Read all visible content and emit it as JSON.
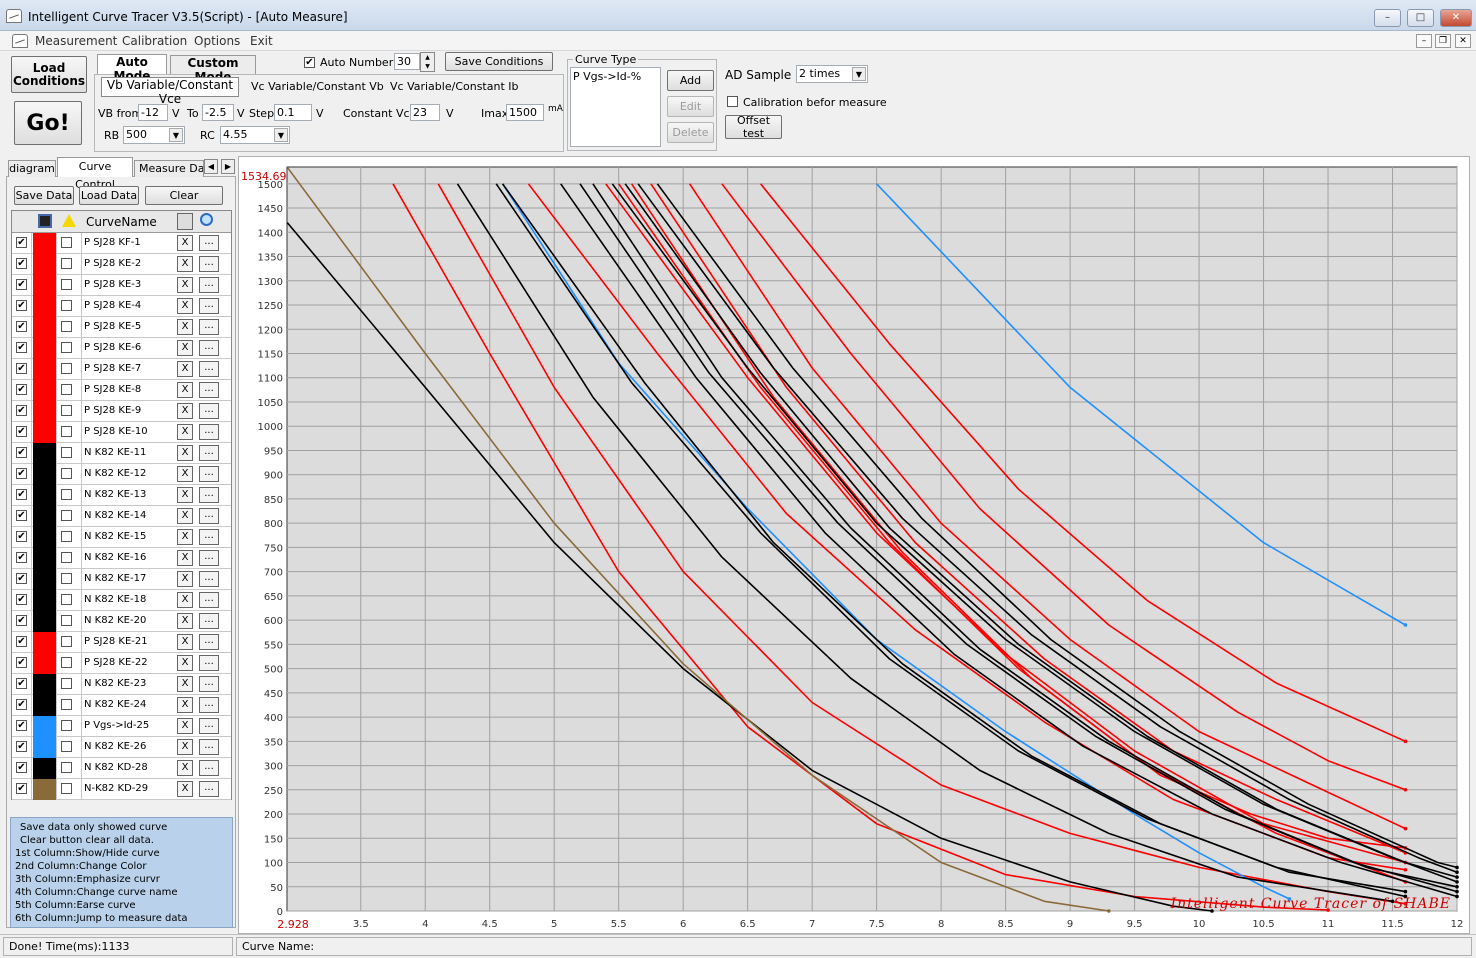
{
  "window": {
    "title": "Intelligent Curve Tracer V3.5(Script) - [Auto Measure]"
  },
  "menu": [
    "Measurement",
    "Calibration",
    "Options",
    "Exit"
  ],
  "toolbar": {
    "load_conditions": "Load\nConditions",
    "go": "Go!",
    "auto_mode": "Auto Mode",
    "custom_mode": "Custom Mode",
    "auto_number_label": "Auto Number",
    "auto_number_value": "30",
    "save_conditions": "Save Conditions",
    "subtabs": [
      "Vb Variable/Constant Vce",
      "Vc Variable/Constant Vb",
      "Vc Variable/Constant Ib"
    ],
    "vb_from_label": "VB from",
    "vb_from_value": "-12",
    "unit_v": "V",
    "to_label": "To",
    "to_value": "-2.5",
    "step_label": "Step",
    "step_value": "0.1",
    "const_vce_label": "Constant Vce",
    "const_vce_value": "23",
    "imax_label": "Imax",
    "imax_value": "1500",
    "imax_unit": "mA",
    "rb_label": "RB",
    "rb_value": "500",
    "rc_label": "RC",
    "rc_value": "4.55"
  },
  "curve_type": {
    "title": "Curve Type",
    "items": [
      "P Vgs->Id-%"
    ],
    "add": "Add",
    "edit": "Edit",
    "delete": "Delete"
  },
  "ad": {
    "label": "AD Sample",
    "value": "2 times",
    "calib_label": "Calibration befor measure",
    "offset_test": "Offset test"
  },
  "left_tabs": [
    "diagram",
    "Curve Control",
    "Measure Data"
  ],
  "left_buttons": {
    "save": "Save Data",
    "load": "Load Data",
    "clear": "Clear"
  },
  "table": {
    "header_name": "CurveName",
    "rows": [
      {
        "name": "P SJ28 KF-1",
        "color": "#ff0000"
      },
      {
        "name": "P  SJ28 KE-2",
        "color": "#ff0000"
      },
      {
        "name": "P SJ28 KE-3",
        "color": "#ff0000"
      },
      {
        "name": "P SJ28 KE-4",
        "color": "#ff0000"
      },
      {
        "name": "P SJ28 KE-5",
        "color": "#ff0000"
      },
      {
        "name": "P SJ28 KE-6",
        "color": "#ff0000"
      },
      {
        "name": "P SJ28 KE-7",
        "color": "#ff0000"
      },
      {
        "name": "P SJ28 KE-8",
        "color": "#ff0000"
      },
      {
        "name": "P SJ28 KE-9",
        "color": "#ff0000"
      },
      {
        "name": "P SJ28 KE-10",
        "color": "#ff0000"
      },
      {
        "name": "N K82 KE-11",
        "color": "#000000"
      },
      {
        "name": "N K82 KE-12",
        "color": "#000000"
      },
      {
        "name": "N  K82 KE-13",
        "color": "#000000"
      },
      {
        "name": "N K82 KE-14",
        "color": "#000000"
      },
      {
        "name": "N  K82 KE-15",
        "color": "#000000"
      },
      {
        "name": "N K82 KE-16",
        "color": "#000000"
      },
      {
        "name": "N K82 KE-17",
        "color": "#000000"
      },
      {
        "name": "N K82 KE-18",
        "color": "#000000"
      },
      {
        "name": "N  K82 KE-20",
        "color": "#000000"
      },
      {
        "name": "P SJ28 KE-21",
        "color": "#ff0000"
      },
      {
        "name": "P SJ28 KE-22",
        "color": "#ff0000"
      },
      {
        "name": "N K82 KE-23",
        "color": "#000000"
      },
      {
        "name": "N  K82 KE-24",
        "color": "#000000"
      },
      {
        "name": "P Vgs->Id-25",
        "color": "#1e90ff"
      },
      {
        "name": "N  K82 KE-26",
        "color": "#1e90ff"
      },
      {
        "name": "N K82 KD-28",
        "color": "#000000"
      },
      {
        "name": "N-K82 KD-29",
        "color": "#8b6a3a"
      }
    ],
    "x_label": "X",
    "dots_label": "..."
  },
  "help": [
    "Save data only showed curve",
    "Clear button clear all data.",
    "1st Column:Show/Hide curve",
    "2nd Column:Change Color",
    "3th Column:Emphasize curvr",
    "4th Column:Change curve name",
    "5th Column:Earse curve",
    "6th Column:Jump to measure data"
  ],
  "status": {
    "left": "Done!  Time(ms):1133",
    "right": "Curve Name:"
  },
  "chart_data": {
    "type": "line",
    "x_ticks": [
      3.5,
      4,
      4.5,
      5,
      5.5,
      6,
      6.5,
      7,
      7.5,
      8,
      8.5,
      9,
      9.5,
      10,
      10.5,
      11,
      11.5,
      12
    ],
    "y_ticks": [
      0,
      50,
      100,
      150,
      200,
      250,
      300,
      350,
      400,
      450,
      500,
      550,
      600,
      650,
      700,
      750,
      800,
      850,
      900,
      950,
      1000,
      1050,
      1100,
      1150,
      1200,
      1250,
      1300,
      1350,
      1400,
      1450,
      1500
    ],
    "xlim": [
      2.928,
      12
    ],
    "ylim": [
      0,
      1534.69
    ],
    "x_min_label": "2.928",
    "y_max_label": "1534.69",
    "grid": true,
    "watermark": "Intelligent Curve Tracer of SHABE",
    "series": [
      {
        "color": "#ff0000",
        "points": [
          [
            3.75,
            1500
          ],
          [
            4.5,
            1150
          ],
          [
            5.5,
            700
          ],
          [
            6.5,
            380
          ],
          [
            7.5,
            180
          ],
          [
            8.5,
            75
          ],
          [
            9.5,
            30
          ],
          [
            10.5,
            8
          ],
          [
            11,
            2
          ]
        ]
      },
      {
        "color": "#ff0000",
        "points": [
          [
            4.1,
            1500
          ],
          [
            5,
            1080
          ],
          [
            6,
            700
          ],
          [
            7,
            430
          ],
          [
            8,
            260
          ],
          [
            9,
            160
          ],
          [
            10,
            90
          ],
          [
            11,
            40
          ],
          [
            11.6,
            15
          ]
        ]
      },
      {
        "color": "#1e90ff",
        "points": [
          [
            4.6,
            1500
          ],
          [
            5.5,
            1130
          ],
          [
            6.5,
            830
          ],
          [
            7.5,
            560
          ],
          [
            8.5,
            370
          ],
          [
            9.5,
            200
          ],
          [
            10,
            120
          ],
          [
            10.5,
            50
          ],
          [
            10.7,
            25
          ]
        ]
      },
      {
        "color": "#ff0000",
        "points": [
          [
            4.8,
            1500
          ],
          [
            5.8,
            1150
          ],
          [
            6.8,
            820
          ],
          [
            7.8,
            580
          ],
          [
            8.8,
            390
          ],
          [
            9.8,
            230
          ],
          [
            10.5,
            160
          ],
          [
            11,
            110
          ],
          [
            11.6,
            85
          ]
        ]
      },
      {
        "color": "#ff0000",
        "points": [
          [
            5.75,
            1500
          ],
          [
            6.8,
            1080
          ],
          [
            7.8,
            760
          ],
          [
            8.8,
            520
          ],
          [
            9.8,
            330
          ],
          [
            10.6,
            230
          ],
          [
            11.6,
            120
          ]
        ]
      },
      {
        "color": "#ff0000",
        "points": [
          [
            6.05,
            1500
          ],
          [
            7,
            1120
          ],
          [
            8,
            800
          ],
          [
            9,
            560
          ],
          [
            10,
            370
          ],
          [
            10.8,
            270
          ],
          [
            11.6,
            170
          ]
        ]
      },
      {
        "color": "#ff0000",
        "points": [
          [
            6.3,
            1500
          ],
          [
            7.3,
            1150
          ],
          [
            8.3,
            830
          ],
          [
            9.3,
            590
          ],
          [
            10.3,
            410
          ],
          [
            11,
            310
          ],
          [
            11.6,
            250
          ]
        ]
      },
      {
        "color": "#ff0000",
        "points": [
          [
            6.6,
            1500
          ],
          [
            7.6,
            1170
          ],
          [
            8.6,
            870
          ],
          [
            9.6,
            640
          ],
          [
            10.6,
            470
          ],
          [
            11.6,
            350
          ]
        ]
      },
      {
        "color": "#ff0000",
        "points": [
          [
            5.4,
            1500
          ],
          [
            6.5,
            1100
          ],
          [
            7.5,
            780
          ],
          [
            8.5,
            530
          ],
          [
            9.5,
            330
          ],
          [
            10.5,
            180
          ],
          [
            11.6,
            100
          ]
        ]
      },
      {
        "color": "#ff0000",
        "points": [
          [
            5.5,
            1500
          ],
          [
            6.6,
            1080
          ],
          [
            7.6,
            760
          ],
          [
            8.6,
            500
          ],
          [
            9.6,
            300
          ],
          [
            10.6,
            160
          ],
          [
            11.6,
            60
          ]
        ]
      },
      {
        "color": "#ff0000",
        "points": [
          [
            5.6,
            1500
          ],
          [
            6.7,
            1060
          ],
          [
            7.7,
            740
          ],
          [
            8.7,
            480
          ],
          [
            9.7,
            280
          ],
          [
            10.4,
            200
          ],
          [
            11,
            150
          ],
          [
            11.6,
            130
          ]
        ]
      },
      {
        "color": "#1e90ff",
        "points": [
          [
            7.5,
            1500
          ],
          [
            9,
            1080
          ],
          [
            10.5,
            760
          ],
          [
            11.6,
            590
          ]
        ]
      },
      {
        "color": "#000000",
        "points": [
          [
            2.93,
            1420
          ],
          [
            4,
            1080
          ],
          [
            5,
            760
          ],
          [
            6,
            500
          ],
          [
            7,
            290
          ],
          [
            8,
            150
          ],
          [
            9,
            60
          ],
          [
            9.8,
            10
          ],
          [
            10.1,
            0
          ]
        ]
      },
      {
        "color": "#8b6a3a",
        "points": [
          [
            2.93,
            1534
          ],
          [
            4,
            1150
          ],
          [
            5,
            800
          ],
          [
            6,
            510
          ],
          [
            7,
            280
          ],
          [
            8,
            100
          ],
          [
            8.8,
            20
          ],
          [
            9.3,
            0
          ]
        ]
      },
      {
        "color": "#000000",
        "points": [
          [
            4.25,
            1500
          ],
          [
            5.3,
            1060
          ],
          [
            6.3,
            730
          ],
          [
            7.3,
            480
          ],
          [
            8.3,
            290
          ],
          [
            9.3,
            160
          ],
          [
            10.3,
            70
          ],
          [
            11.5,
            20
          ]
        ]
      },
      {
        "color": "#000000",
        "points": [
          [
            4.55,
            1500
          ],
          [
            5.6,
            1090
          ],
          [
            6.6,
            780
          ],
          [
            7.6,
            520
          ],
          [
            8.6,
            330
          ],
          [
            9.6,
            190
          ],
          [
            10.6,
            90
          ],
          [
            11.6,
            30
          ]
        ]
      },
      {
        "color": "#000000",
        "points": [
          [
            4.6,
            1500
          ],
          [
            5.7,
            1090
          ],
          [
            6.7,
            760
          ],
          [
            7.7,
            510
          ],
          [
            8.7,
            320
          ],
          [
            9.7,
            180
          ],
          [
            10.7,
            80
          ],
          [
            11.6,
            40
          ]
        ]
      },
      {
        "color": "#000000",
        "points": [
          [
            5.05,
            1500
          ],
          [
            6.1,
            1100
          ],
          [
            7.1,
            780
          ],
          [
            8.1,
            530
          ],
          [
            9.1,
            340
          ],
          [
            10.1,
            200
          ],
          [
            11.1,
            100
          ],
          [
            12,
            30
          ]
        ]
      },
      {
        "color": "#000000",
        "points": [
          [
            5.2,
            1500
          ],
          [
            6.2,
            1110
          ],
          [
            7.2,
            800
          ],
          [
            8.2,
            550
          ],
          [
            9.2,
            360
          ],
          [
            10.2,
            210
          ],
          [
            11.2,
            100
          ],
          [
            12,
            40
          ]
        ]
      },
      {
        "color": "#000000",
        "points": [
          [
            5.3,
            1500
          ],
          [
            6.3,
            1100
          ],
          [
            7.3,
            790
          ],
          [
            8.3,
            540
          ],
          [
            9.3,
            350
          ],
          [
            10.3,
            200
          ],
          [
            11.3,
            90
          ],
          [
            12,
            50
          ]
        ]
      },
      {
        "color": "#000000",
        "points": [
          [
            5.45,
            1500
          ],
          [
            6.5,
            1120
          ],
          [
            7.5,
            800
          ],
          [
            8.5,
            560
          ],
          [
            9.5,
            370
          ],
          [
            10.5,
            220
          ],
          [
            11.5,
            110
          ],
          [
            12,
            60
          ]
        ]
      },
      {
        "color": "#000000",
        "points": [
          [
            5.55,
            1500
          ],
          [
            6.6,
            1110
          ],
          [
            7.6,
            790
          ],
          [
            8.6,
            550
          ],
          [
            9.6,
            360
          ],
          [
            10.6,
            210
          ],
          [
            11.6,
            100
          ],
          [
            12,
            70
          ]
        ]
      },
      {
        "color": "#000000",
        "points": [
          [
            5.65,
            1500
          ],
          [
            6.7,
            1120
          ],
          [
            7.7,
            810
          ],
          [
            8.7,
            570
          ],
          [
            9.7,
            380
          ],
          [
            10.7,
            230
          ],
          [
            11.7,
            110
          ],
          [
            12,
            80
          ]
        ]
      },
      {
        "color": "#000000",
        "points": [
          [
            5.8,
            1500
          ],
          [
            6.85,
            1120
          ],
          [
            7.85,
            810
          ],
          [
            8.85,
            560
          ],
          [
            9.85,
            370
          ],
          [
            10.85,
            220
          ],
          [
            11.85,
            100
          ],
          [
            12,
            90
          ]
        ]
      }
    ]
  }
}
